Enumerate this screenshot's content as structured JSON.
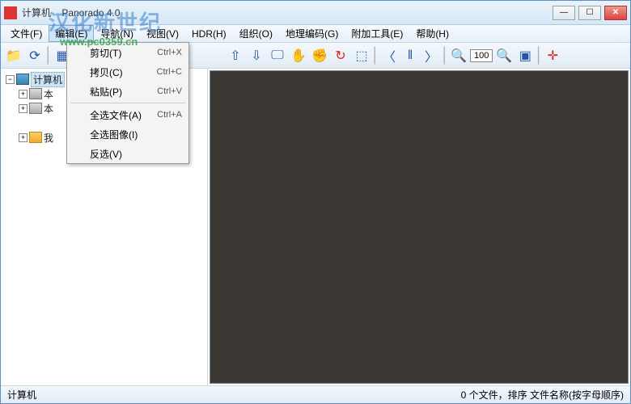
{
  "title": {
    "prefix": "计算机",
    "app": "Panorado 4.0"
  },
  "watermark": {
    "big": "汉化新世纪",
    "url": "www.pc0359.cn"
  },
  "menu": {
    "file": "文件(F)",
    "edit": "编辑(E)",
    "nav": "导航(N)",
    "view": "视图(V)",
    "hdr": "HDR(H)",
    "org": "组织(O)",
    "geo": "地理编码(G)",
    "tools": "附加工具(E)",
    "help": "帮助(H)"
  },
  "edit_menu": {
    "cut": {
      "label": "剪切(T)",
      "shortcut": "Ctrl+X"
    },
    "copy": {
      "label": "拷贝(C)",
      "shortcut": "Ctrl+C"
    },
    "paste": {
      "label": "粘贴(P)",
      "shortcut": "Ctrl+V"
    },
    "select_all_files": {
      "label": "全选文件(A)",
      "shortcut": "Ctrl+A"
    },
    "select_all_images": {
      "label": "全选图像(I)",
      "shortcut": ""
    },
    "invert": {
      "label": "反选(V)",
      "shortcut": ""
    }
  },
  "tree": {
    "root": "计算机",
    "item1": "本",
    "item2": "本",
    "item3": "我"
  },
  "toolbar": {
    "zoom_value": "100"
  },
  "status": {
    "left": "计算机",
    "right": "0 个文件，排序 文件名称(按字母顺序)"
  }
}
